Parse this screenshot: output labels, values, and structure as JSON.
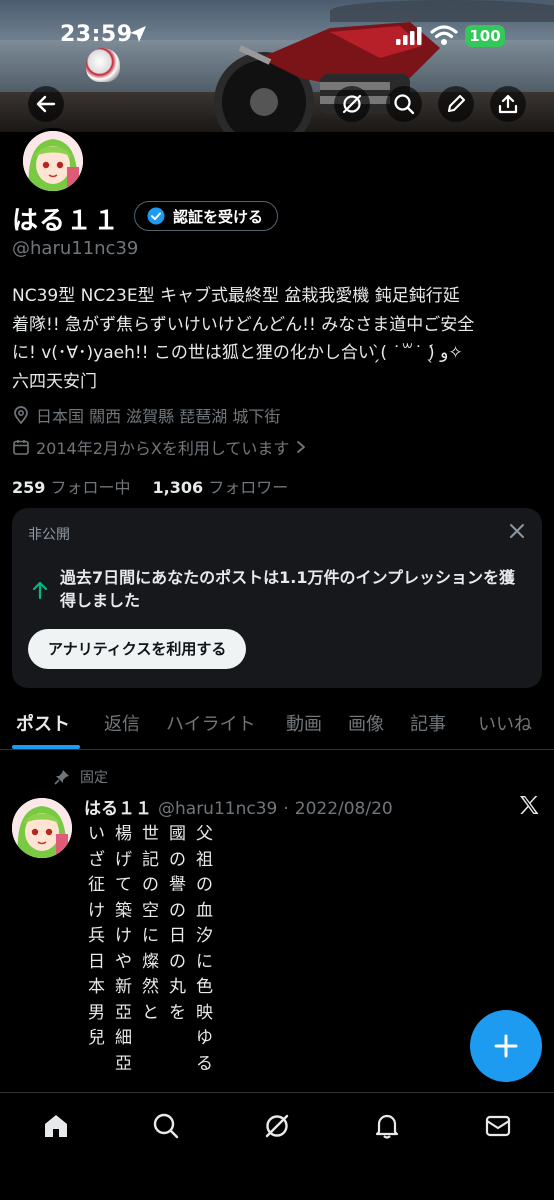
{
  "status_bar": {
    "time": "23:59",
    "battery": "100"
  },
  "colors": {
    "accent": "#1d9bf0",
    "battery_green": "#34c759",
    "growth_green": "#00ba7c"
  },
  "header_actions": [
    {
      "icon": "back-arrow-icon"
    },
    {
      "icon": "grok-icon"
    },
    {
      "icon": "search-icon"
    },
    {
      "icon": "edit-icon"
    },
    {
      "icon": "share-icon"
    }
  ],
  "profile": {
    "display_name": "はる１１",
    "verify_label": "認証を受ける",
    "handle": "@haru11nc39",
    "bio_lines": [
      "NC39型 NC23E型 キャブ式最終型 盆栽我愛機 鈍足鈍行延",
      "着隊!! 急がず焦らずいけいけどんどん!! みなさま道中ご安全",
      "に! v(･∀･)yaeh!! この世は狐と狸の化かし合い ̗̀( ˙꒳​˙ )̖́ ‎و✧",
      "六四天安门"
    ],
    "location": "日本国 關西 滋賀縣 琵琶湖 城下街",
    "joined": "2014年2月からXを利用しています",
    "following_count": "259",
    "following_label": "フォロー中",
    "followers_count": "1,306",
    "followers_label": "フォロワー"
  },
  "private_card": {
    "label": "非公開",
    "text": "過去7日間にあなたのポストは1.1万件のインプレッションを獲得しました",
    "button": "アナリティクスを利用する"
  },
  "tabs": [
    "ポスト",
    "返信",
    "ハイライト",
    "動画",
    "画像",
    "記事",
    "いいね"
  ],
  "active_tab": "ポスト",
  "pinned_post": {
    "pinned_label": "固定",
    "name": "はる１１",
    "handle": "@haru11nc39",
    "separator": "·",
    "date": "2022/08/20",
    "columns": [
      "父祖の血汐に色映ゆる",
      "國の譽の日の丸を",
      "世記の空に燦然と",
      "楊げて築けや新亞細亞",
      "いざ征け兵日本男兒"
    ]
  },
  "fab": {
    "icon": "plus-icon"
  },
  "bottom_nav": [
    "home-icon",
    "search-icon",
    "grok-icon",
    "notifications-icon",
    "messages-icon"
  ]
}
